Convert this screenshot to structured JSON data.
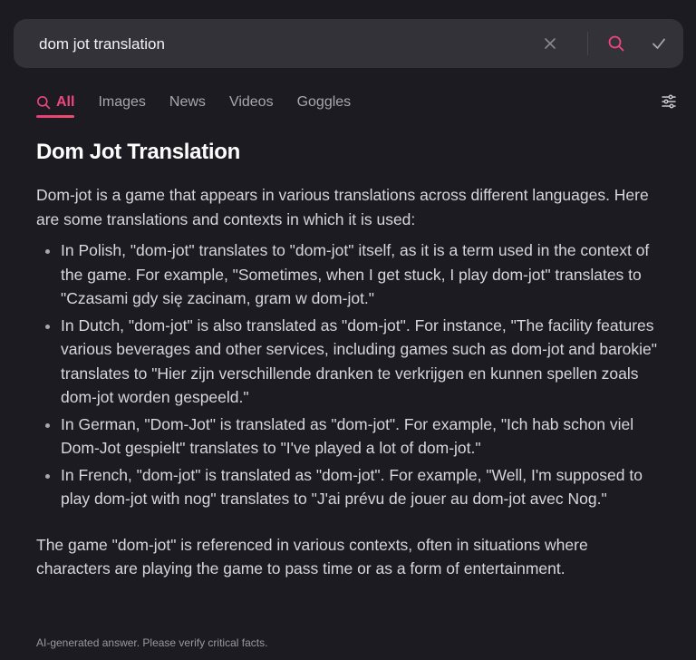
{
  "search": {
    "query": "dom jot translation",
    "icons": {
      "clear": "close-icon",
      "submit": "search-icon",
      "confirm": "check-icon"
    }
  },
  "tabs": [
    {
      "label": "All",
      "active": true,
      "icon": "search-icon"
    },
    {
      "label": "Images",
      "active": false
    },
    {
      "label": "News",
      "active": false
    },
    {
      "label": "Videos",
      "active": false
    },
    {
      "label": "Goggles",
      "active": false
    }
  ],
  "filter_icon": "sliders-icon",
  "answer": {
    "title": "Dom Jot Translation",
    "intro": "Dom-jot is a game that appears in various translations across different languages. Here are some translations and contexts in which it is used:",
    "items": [
      "In Polish, \"dom-jot\" translates to \"dom-jot\" itself, as it is a term used in the context of the game. For example, \"Sometimes, when I get stuck, I play dom-jot\" translates to \"Czasami gdy się zacinam, gram w dom-jot.\"",
      "In Dutch, \"dom-jot\" is also translated as \"dom-jot\". For instance, \"The facility features various beverages and other services, including games such as dom-jot and barokie\" translates to \"Hier zijn verschillende dranken te verkrijgen en kunnen spellen zoals dom-jot worden gespeeld.\"",
      "In German, \"Dom-Jot\" is translated as \"dom-jot\". For example, \"Ich hab schon viel Dom-Jot gespielt\" translates to \"I've played a lot of dom-jot.\"",
      "In French, \"dom-jot\" is translated as \"dom-jot\". For example, \"Well, I'm supposed to play dom-jot with nog\" translates to \"J'ai prévu de jouer au dom-jot avec Nog.\""
    ],
    "conclusion": "The game \"dom-jot\" is referenced in various contexts, often in situations where characters are playing the game to pass time or as a form of entertainment."
  },
  "disclaimer": "AI-generated answer. Please verify critical facts.",
  "colors": {
    "accent": "#f0467d",
    "background": "#1c1b21",
    "searchbar": "#323238"
  }
}
